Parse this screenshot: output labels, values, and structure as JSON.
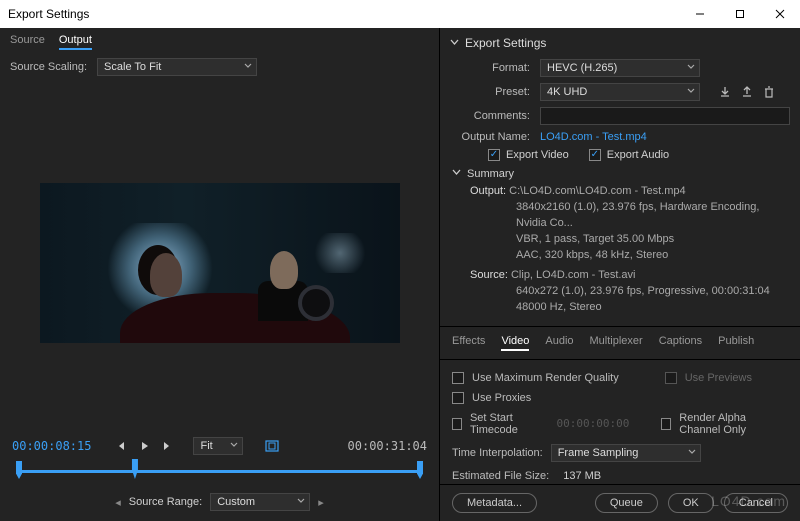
{
  "window": {
    "title": "Export Settings"
  },
  "left": {
    "tabs": {
      "source": "Source",
      "output": "Output",
      "active": "output"
    },
    "source_scaling_label": "Source Scaling:",
    "source_scaling_value": "Scale To Fit",
    "current_time": "00:00:08:15",
    "duration": "00:00:31:04",
    "fit_label": "Fit",
    "source_range_label": "Source Range:",
    "source_range_value": "Custom"
  },
  "export": {
    "section_title": "Export Settings",
    "format_label": "Format:",
    "format_value": "HEVC (H.265)",
    "preset_label": "Preset:",
    "preset_value": "4K UHD",
    "comments_label": "Comments:",
    "comments_value": "",
    "output_name_label": "Output Name:",
    "output_name_value": "LO4D.com - Test.mp4",
    "export_video_label": "Export Video",
    "export_audio_label": "Export Audio",
    "export_video_checked": true,
    "export_audio_checked": true
  },
  "summary": {
    "title": "Summary",
    "output_label": "Output:",
    "output_line1": "C:\\LO4D.com\\LO4D.com - Test.mp4",
    "output_line2": "3840x2160 (1.0), 23.976 fps, Hardware Encoding, Nvidia Co...",
    "output_line3": "VBR, 1 pass, Target 35.00 Mbps",
    "output_line4": "AAC, 320 kbps, 48 kHz, Stereo",
    "source_label": "Source:",
    "source_line1": "Clip, LO4D.com - Test.avi",
    "source_line2": "640x272 (1.0), 23.976 fps, Progressive, 00:00:31:04",
    "source_line3": "48000 Hz, Stereo"
  },
  "right_tabs": {
    "effects": "Effects",
    "video": "Video",
    "audio": "Audio",
    "multiplexer": "Multiplexer",
    "captions": "Captions",
    "publish": "Publish",
    "active": "video"
  },
  "options": {
    "max_render": "Use Maximum Render Quality",
    "use_previews": "Use Previews",
    "use_proxies": "Use Proxies",
    "set_start_tc": "Set Start Timecode",
    "start_tc_value": "00:00:00:00",
    "render_alpha": "Render Alpha Channel Only",
    "time_interp_label": "Time Interpolation:",
    "time_interp_value": "Frame Sampling",
    "est_size_label": "Estimated File Size:",
    "est_size_value": "137 MB"
  },
  "footer": {
    "metadata": "Metadata...",
    "queue": "Queue",
    "ok": "OK",
    "cancel": "Cancel"
  },
  "watermark": "LO4D.com"
}
